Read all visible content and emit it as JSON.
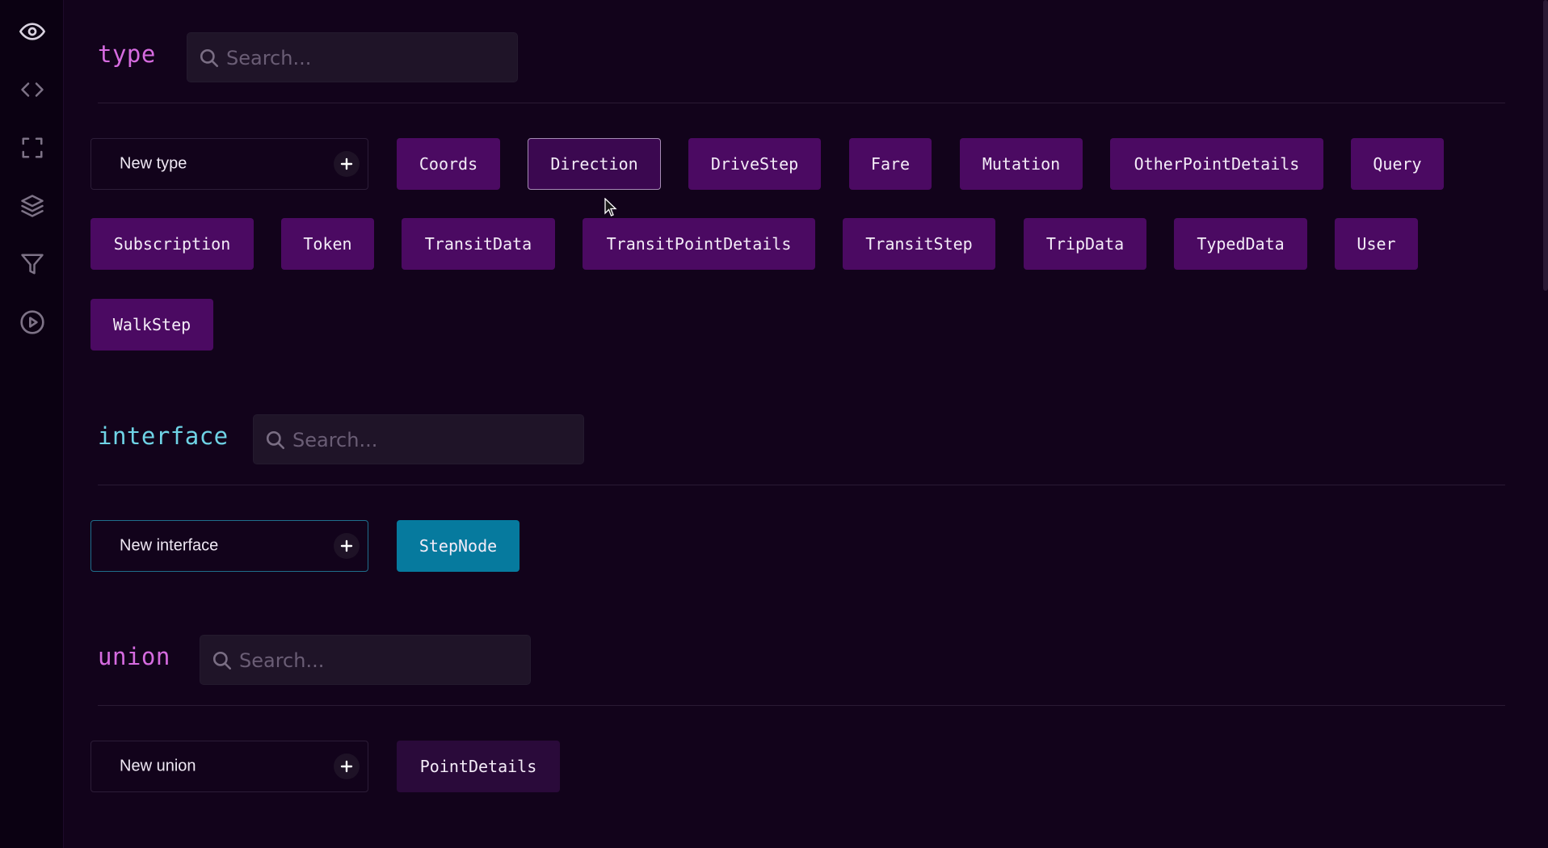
{
  "sidebar": {
    "icons": [
      "eye-icon",
      "code-icon",
      "fullscreen-icon",
      "layers-icon",
      "filter-icon",
      "play-icon"
    ]
  },
  "sections": {
    "type": {
      "title": "type",
      "search_placeholder": "Search...",
      "new_label": "New type",
      "items": [
        "Coords",
        "Direction",
        "DriveStep",
        "Fare",
        "Mutation",
        "OtherPointDetails",
        "Query",
        "Subscription",
        "Token",
        "TransitData",
        "TransitPointDetails",
        "TransitStep",
        "TripData",
        "TypedData",
        "User",
        "WalkStep"
      ],
      "selected": "Direction"
    },
    "interface": {
      "title": "interface",
      "search_placeholder": "Search...",
      "new_label": "New interface",
      "items": [
        "StepNode"
      ]
    },
    "union": {
      "title": "union",
      "search_placeholder": "Search...",
      "new_label": "New union",
      "items": [
        "PointDetails"
      ]
    }
  },
  "colors": {
    "background": "#12031b",
    "type_title": "#d66be0",
    "interface_title": "#6fd3e6",
    "union_title": "#d66be0",
    "type_chip": "#4b0a62",
    "interface_chip": "#067a9e",
    "union_chip": "#2a0a3a"
  }
}
